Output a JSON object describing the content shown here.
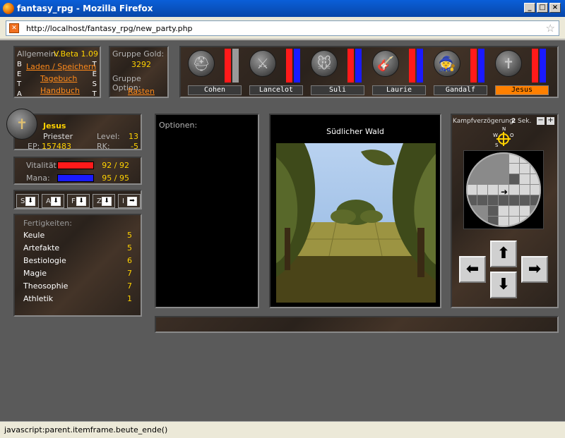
{
  "window": {
    "title": "fantasy_rpg - Mozilla Firefox"
  },
  "address": {
    "url": "http://localhost/fantasy_rpg/new_party.php"
  },
  "general": {
    "label": "Allgemein:",
    "version": "V.Beta 1.09",
    "links": [
      "Laden / Speichern",
      "Tagebuch",
      "Handbuch"
    ],
    "beta_letters": [
      "B",
      "E",
      "T",
      "A"
    ],
    "test_letters": [
      "T",
      "E",
      "S",
      "T"
    ]
  },
  "group": {
    "gold_label": "Gruppe Gold:",
    "gold_value": "3292",
    "option_label": "Gruppe Option:",
    "rest_link": "Rasten"
  },
  "party": [
    {
      "name": "Cohen",
      "icon": "viking-helmet-axe-icon",
      "glyph": "⛑",
      "active": false,
      "has_mana": false
    },
    {
      "name": "Lancelot",
      "icon": "shield-sword-icon",
      "glyph": "⚔",
      "active": false,
      "has_mana": true
    },
    {
      "name": "Suli",
      "icon": "mouse-icon",
      "glyph": "🐭",
      "active": false,
      "has_mana": true
    },
    {
      "name": "Laurie",
      "icon": "lute-icon",
      "glyph": "🎸",
      "active": false,
      "has_mana": true
    },
    {
      "name": "Gandalf",
      "icon": "wizard-hat-icon",
      "glyph": "🧙",
      "active": false,
      "has_mana": true
    },
    {
      "name": "Jesus",
      "icon": "priest-mitre-icon",
      "glyph": "✝",
      "active": true,
      "has_mana": true
    }
  ],
  "character": {
    "name": "Jesus",
    "class": "Priester",
    "level_label": "Level:",
    "level": "13",
    "ep_label": "EP:",
    "ep": "157483",
    "rk_label": "RK:",
    "rk": "-5",
    "vit_label": "Vitalität:",
    "vit_value": "92 / 92",
    "mana_label": "Mana:",
    "mana_value": "95 / 95",
    "vit_fraction": 1.0,
    "mana_fraction": 1.0
  },
  "buttons": [
    {
      "key": "S",
      "arrow": "⬇"
    },
    {
      "key": "A",
      "arrow": "⬇"
    },
    {
      "key": "F",
      "arrow": "⬇"
    },
    {
      "key": "Z",
      "arrow": "⬇"
    },
    {
      "key": "I",
      "arrow": "➡"
    }
  ],
  "skills": {
    "label": "Fertigkeiten:",
    "items": [
      {
        "name": "Keule",
        "value": "5"
      },
      {
        "name": "Artefakte",
        "value": "5"
      },
      {
        "name": "Bestiologie",
        "value": "6"
      },
      {
        "name": "Magie",
        "value": "7"
      },
      {
        "name": "Theosophie",
        "value": "7"
      },
      {
        "name": "Athletik",
        "value": "1"
      }
    ]
  },
  "options": {
    "label": "Optionen:"
  },
  "scene": {
    "location": "Südlicher Wald"
  },
  "combat": {
    "delay_label": "Kampfverzögerung:",
    "delay_value": "2",
    "delay_unit": "Sek.",
    "minus": "−",
    "plus": "+"
  },
  "compass": {
    "n": "N",
    "w": "W",
    "o": "O",
    "s": "S"
  },
  "nav": {
    "up": "⬆",
    "left": "⬅",
    "right": "➡",
    "down": "⬇"
  },
  "statusbar": {
    "text": "javascript:parent.itemframe.beute_ende()"
  },
  "colors": {
    "accent": "#ff8a1a",
    "name": "#ffd200",
    "vit": "#ff1a1a",
    "mana": "#1a1aff"
  }
}
